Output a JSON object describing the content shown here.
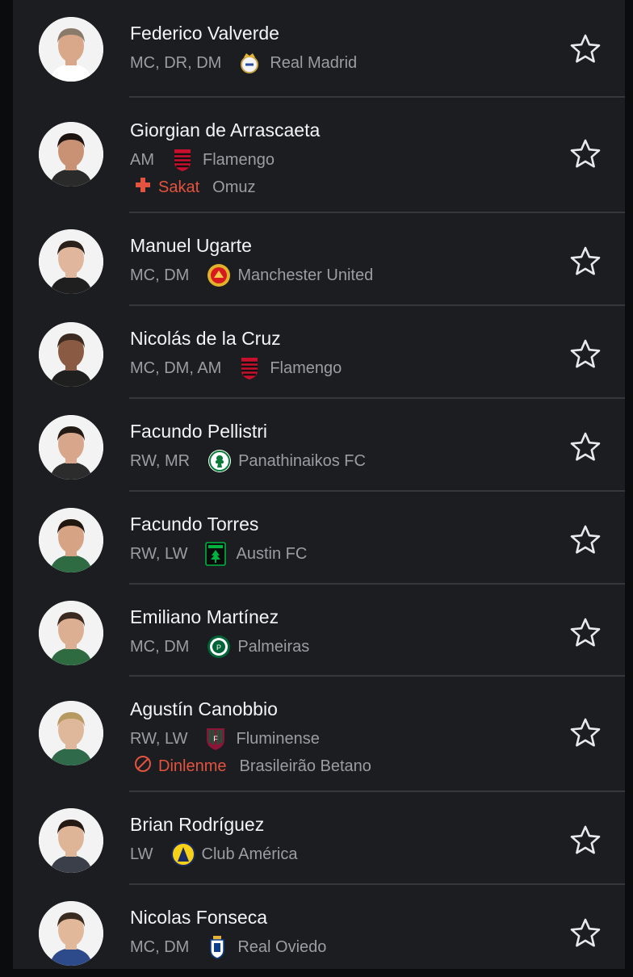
{
  "players": [
    {
      "name": "Federico Valverde",
      "positions": "MC, DR, DM",
      "club": "Real Madrid",
      "crest": "real-madrid-crest-icon",
      "skin": "#d9a88b",
      "hair": "#8a7a6a",
      "shirt": "#ffffff"
    },
    {
      "name": "Giorgian de Arrascaeta",
      "positions": "AM",
      "club": "Flamengo",
      "crest": "flamengo-crest-icon",
      "skin": "#c99274",
      "hair": "#1c1410",
      "shirt": "#2a2a2a",
      "status": {
        "icon": "injury-cross-icon",
        "label": "Sakat",
        "detail": "Omuz"
      }
    },
    {
      "name": "Manuel Ugarte",
      "positions": "MC, DM",
      "club": "Manchester United",
      "crest": "manchester-united-crest-icon",
      "skin": "#e0b79c",
      "hair": "#2b211b",
      "shirt": "#1f1f1f"
    },
    {
      "name": "Nicolás de la Cruz",
      "positions": "MC, DM, AM",
      "club": "Flamengo",
      "crest": "flamengo-crest-icon",
      "skin": "#8a5a43",
      "hair": "#3a2a22",
      "shirt": "#1f1f1f"
    },
    {
      "name": "Facundo Pellistri",
      "positions": "RW, MR",
      "club": "Panathinaikos FC",
      "crest": "panathinaikos-crest-icon",
      "skin": "#d8a78b",
      "hair": "#231a15",
      "shirt": "#2c2c2c"
    },
    {
      "name": "Facundo Torres",
      "positions": "RW, LW",
      "club": "Austin FC",
      "crest": "austin-fc-crest-icon",
      "skin": "#d7a385",
      "hair": "#20170f",
      "shirt": "#2e6a42"
    },
    {
      "name": "Emiliano Martínez",
      "positions": "MC, DM",
      "club": "Palmeiras",
      "crest": "palmeiras-crest-icon",
      "skin": "#dcae92",
      "hair": "#3a2a1f",
      "shirt": "#2f6b40"
    },
    {
      "name": "Agustín Canobbio",
      "positions": "RW, LW",
      "club": "Fluminense",
      "crest": "fluminense-crest-icon",
      "skin": "#dfb89c",
      "hair": "#b79a62",
      "shirt": "#2f6a4a",
      "status": {
        "icon": "rest-block-icon",
        "label": "Dinlenme",
        "detail": "Brasileirão Betano"
      }
    },
    {
      "name": "Brian Rodríguez",
      "positions": "LW",
      "club": "Club América",
      "crest": "club-america-crest-icon",
      "skin": "#dfb598",
      "hair": "#241a14",
      "shirt": "#3a3f4a"
    },
    {
      "name": "Nicolas Fonseca",
      "positions": "MC, DM",
      "club": "Real Oviedo",
      "crest": "real-oviedo-crest-icon",
      "skin": "#e2b89b",
      "hair": "#3a2b20",
      "shirt": "#2d4a8a"
    }
  ],
  "icons": {
    "favorite": "star-outline-icon"
  },
  "colors": {
    "background": "#1b1d20",
    "alert": "#e4533f",
    "muted": "#9a9da3",
    "text": "#f3f4f6"
  }
}
